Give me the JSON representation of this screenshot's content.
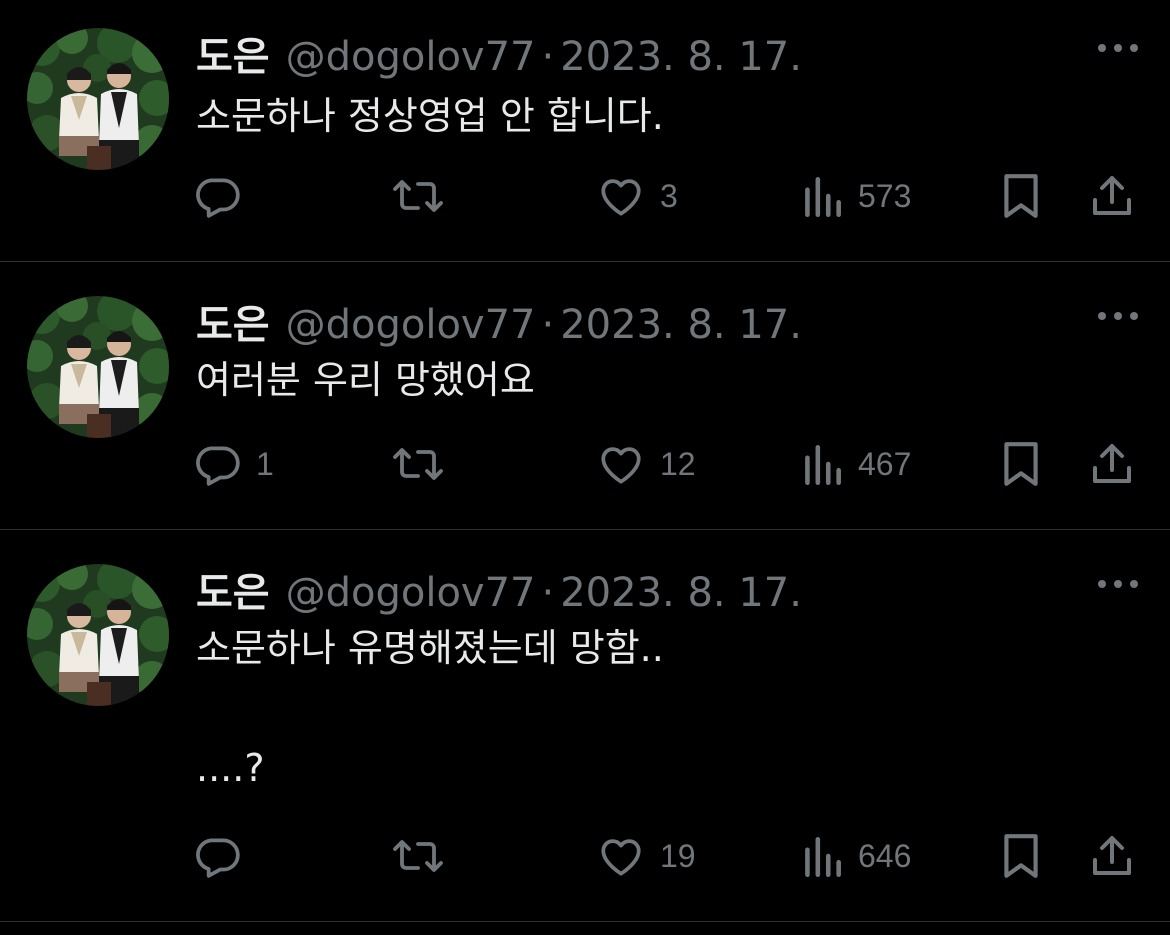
{
  "colors": {
    "background": "#000000",
    "text_primary": "#e7e9ea",
    "text_secondary": "#71767b",
    "divider": "#2f3336"
  },
  "tweets": [
    {
      "name": "도은",
      "handle": "@dogolov77",
      "separator": "·",
      "date": "2023. 8. 17.",
      "text": "소문하나 정상영업 안 합니다.",
      "replies": "",
      "retweets": "",
      "likes": "3",
      "views": "573"
    },
    {
      "name": "도은",
      "handle": "@dogolov77",
      "separator": "·",
      "date": "2023. 8. 17.",
      "text": "여러분 우리 망했어요",
      "replies": "1",
      "retweets": "",
      "likes": "12",
      "views": "467"
    },
    {
      "name": "도은",
      "handle": "@dogolov77",
      "separator": "·",
      "date": "2023. 8. 17.",
      "text": "소문하나 유명해졌는데 망함..\n\n....?",
      "replies": "",
      "retweets": "",
      "likes": "19",
      "views": "646"
    }
  ],
  "icons": {
    "reply": "reply-icon",
    "retweet": "retweet-icon",
    "like": "heart-icon",
    "views": "views-icon",
    "bookmark": "bookmark-icon",
    "share": "share-icon",
    "more": "more-icon"
  }
}
